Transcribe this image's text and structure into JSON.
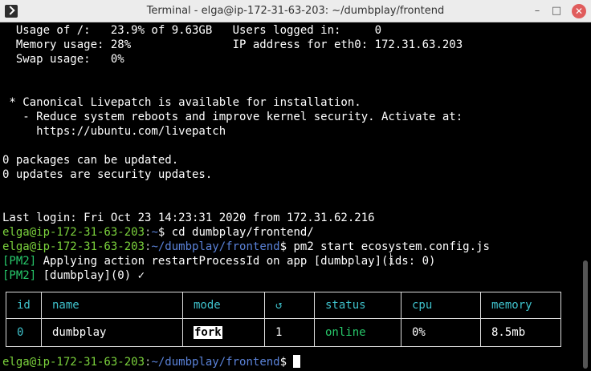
{
  "window": {
    "title": "Terminal - elga@ip-172-31-63-203: ~/dumbplay/frontend",
    "minimize_glyph": "–",
    "maximize_glyph": "□",
    "close_glyph": "✕"
  },
  "terminal": {
    "lines": {
      "usage_root": "  Usage of /:   23.9% of 9.63GB   Users logged in:     0",
      "memory": "  Memory usage: 28%               IP address for eth0: 172.31.63.203",
      "swap": "  Swap usage:   0%",
      "livepatch": " * Canonical Livepatch is available for installation.",
      "livepatch_reduce": "   - Reduce system reboots and improve kernel security. Activate at:",
      "livepatch_url": "     https://ubuntu.com/livepatch",
      "packages": "0 packages can be updated.",
      "security": "0 updates are security updates.",
      "last_login": "Last login: Fri Oct 23 14:23:31 2020 from 172.31.62.216"
    },
    "prompt_user": "elga@ip-172-31-63-203",
    "prompt_sep": ":",
    "prompts": [
      {
        "path": "~",
        "cmd": "$ cd dumbplay/frontend/"
      },
      {
        "path": "~/dumbplay/frontend",
        "cmd": "$ pm2 start ecosystem.config.js"
      },
      {
        "path": "~/dumbplay/frontend",
        "cmd": "$ "
      }
    ],
    "pm2_tag": "[PM2]",
    "pm2_msg1": " Applying action restartProcessId on app [dumbplay](ids: 0)",
    "pm2_msg2": " [dumbplay](0) ✓"
  },
  "pm2_table": {
    "headers": [
      "id",
      "name",
      "mode",
      "↺",
      "status",
      "cpu",
      "memory"
    ],
    "row": {
      "id": "0",
      "name": "dumbplay",
      "mode": "fork",
      "restarts": "1",
      "status": "online",
      "cpu": "0%",
      "memory": "8.5mb"
    }
  },
  "colors": {
    "prompt_user": "#7bd23c",
    "prompt_path": "#5a82d8",
    "pm2_tag": "#27c86a",
    "table_header": "#3fc2cc"
  }
}
